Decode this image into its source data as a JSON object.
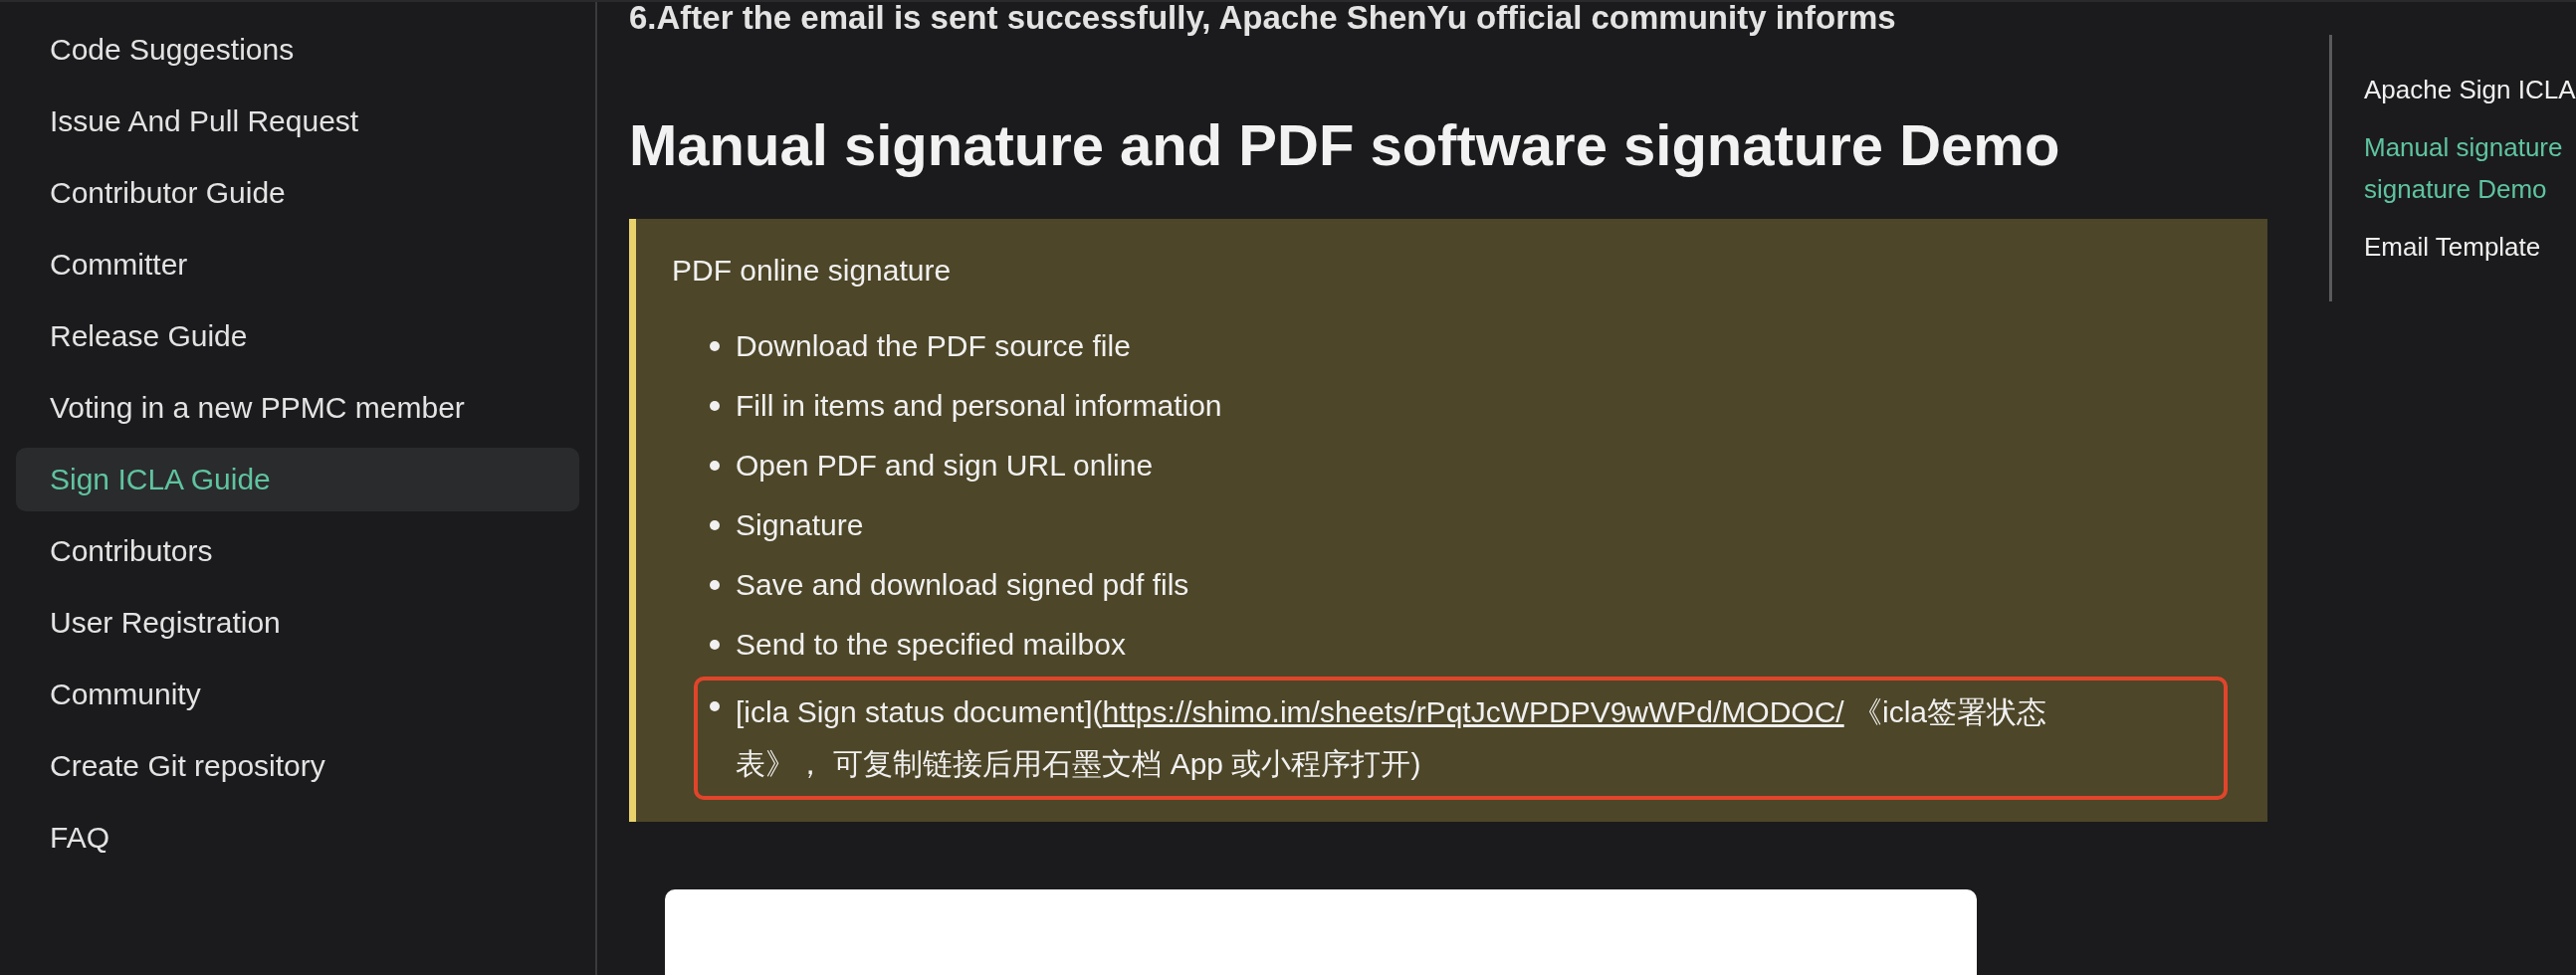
{
  "sidebar": {
    "items": [
      {
        "label": "Code Suggestions",
        "selected": false
      },
      {
        "label": "Issue And Pull Request",
        "selected": false
      },
      {
        "label": "Contributor Guide",
        "selected": false
      },
      {
        "label": "Committer",
        "selected": false
      },
      {
        "label": "Release Guide",
        "selected": false
      },
      {
        "label": "Voting in a new PPMC member",
        "selected": false
      },
      {
        "label": "Sign ICLA Guide",
        "selected": true
      },
      {
        "label": "Contributors",
        "selected": false
      },
      {
        "label": "User Registration",
        "selected": false
      },
      {
        "label": "Community",
        "selected": false
      },
      {
        "label": "Create Git repository",
        "selected": false
      },
      {
        "label": "FAQ",
        "selected": false
      }
    ]
  },
  "content": {
    "cut_heading": "6.After the email is sent successfully, Apache ShenYu official community informs",
    "heading": "Manual signature and PDF software signature Demo",
    "admonition": {
      "title": "PDF online signature",
      "items": [
        {
          "text": "Download the PDF source file",
          "highlighted": false
        },
        {
          "text": "Fill in items and personal information",
          "highlighted": false
        },
        {
          "text": "Open PDF and sign URL online",
          "highlighted": false
        },
        {
          "text": "Signature",
          "highlighted": false
        },
        {
          "text": "Save and download signed pdf fils",
          "highlighted": false
        },
        {
          "text": "Send to the specified mailbox",
          "highlighted": false
        },
        {
          "text": "[icla Sign status document](",
          "link": "https://shimo.im/sheets/rPqtJcWPDPV9wWPd/MODOC/",
          "after": " 《icla签署状态表》， 可复制链接后用石墨文档 App 或小程序打开)",
          "highlighted": true
        }
      ]
    }
  },
  "toc": {
    "items": [
      {
        "lines": [
          "Apache Sign ICLA"
        ],
        "selected": false
      },
      {
        "lines": [
          "Manual signature",
          "signature Demo"
        ],
        "selected": true
      },
      {
        "lines": [
          "Email Template"
        ],
        "selected": false
      }
    ]
  }
}
